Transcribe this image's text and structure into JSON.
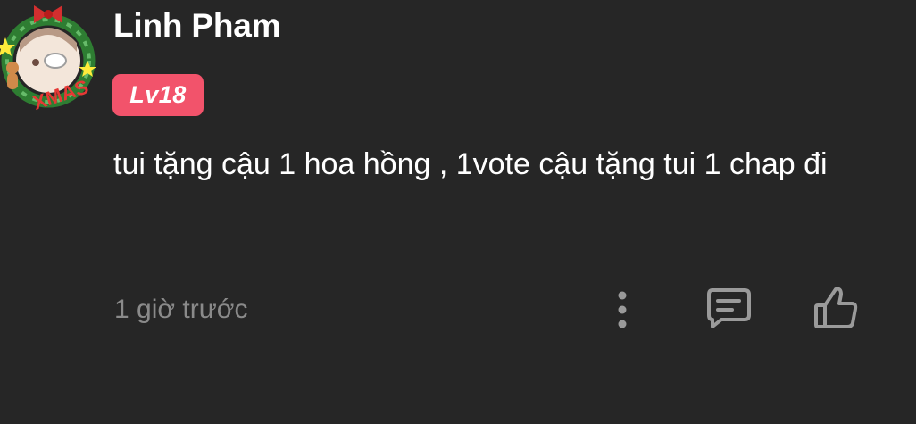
{
  "comment": {
    "author": "Linh Pham",
    "level_badge": "Lv18",
    "text": "tui tặng cậu 1 hoa hồng , 1vote cậu tặng tui 1 chap đi",
    "timestamp": "1 giờ trước",
    "avatar_frame_text": "XMAS"
  },
  "icons": {
    "more": "more-vertical-icon",
    "reply": "comment-icon",
    "like": "thumbs-up-icon"
  },
  "colors": {
    "background": "#262626",
    "badge": "#f2536b",
    "text_primary": "#ffffff",
    "text_secondary": "#8a8a8a",
    "icon": "#9a9a9a"
  }
}
